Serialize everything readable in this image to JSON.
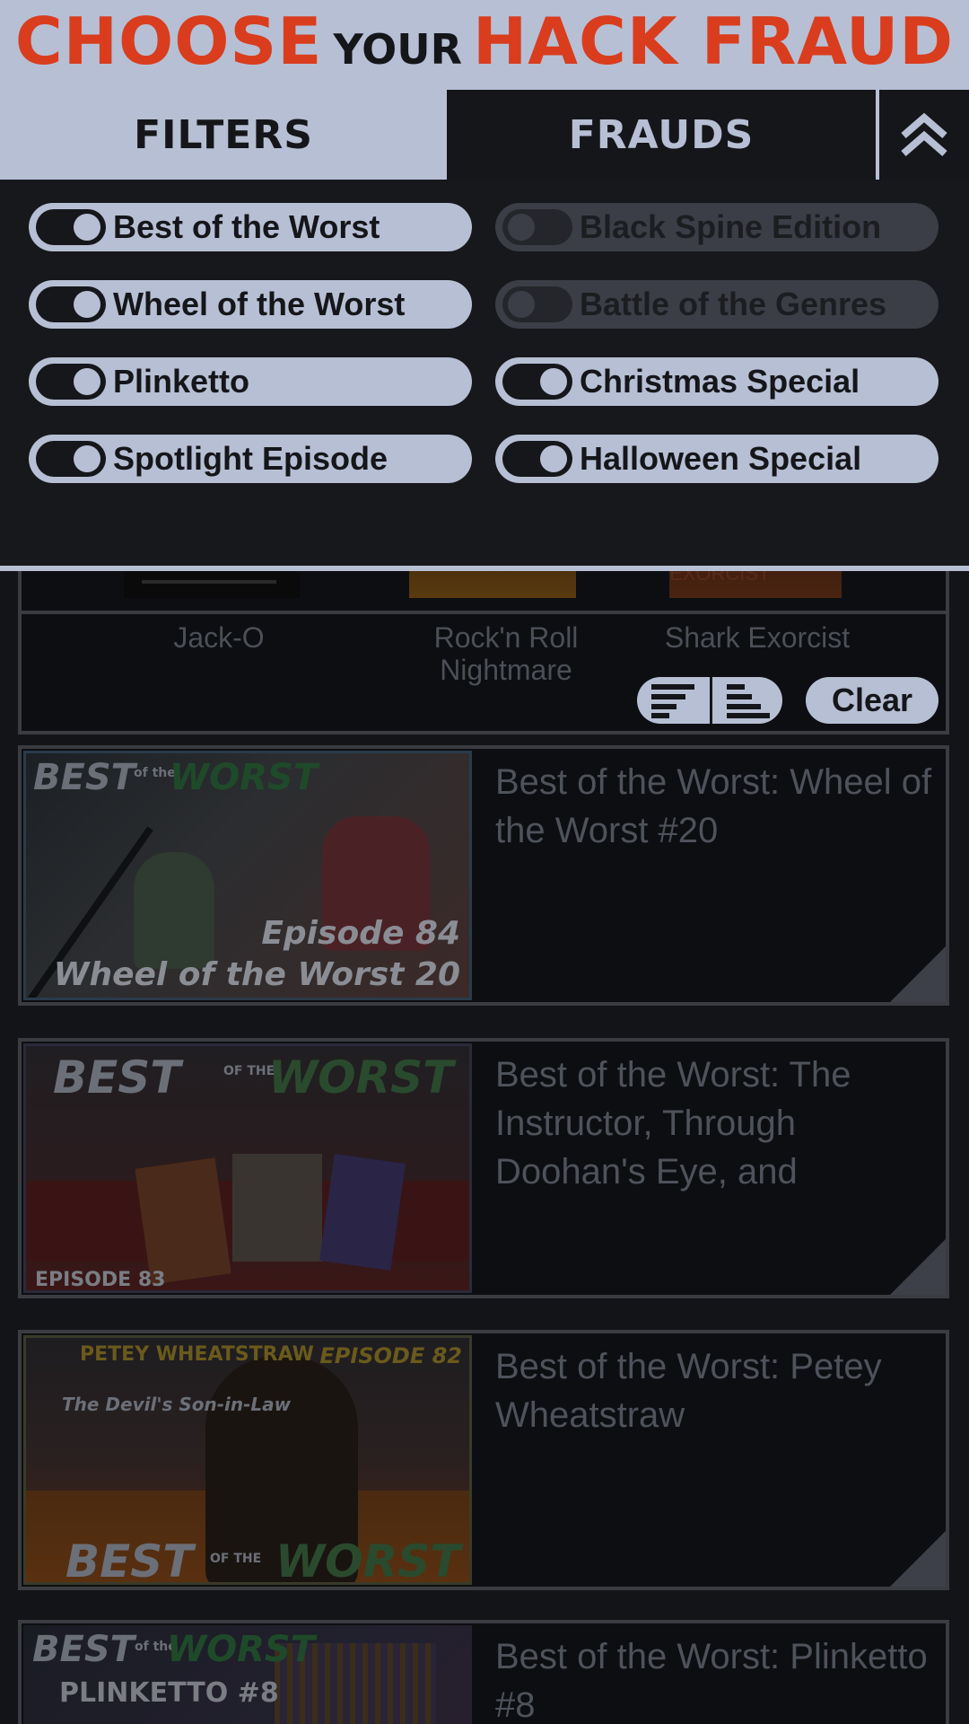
{
  "header": {
    "logo_choose": "CHOOSE",
    "logo_your": "YOUR",
    "logo_hack_fraud": "HACK FRAUD"
  },
  "tabs": {
    "filters_label": "FILTERS",
    "frauds_label": "FRAUDS",
    "collapse_icon": "double-chevron-up-icon"
  },
  "filters": {
    "left": [
      {
        "label": "Best of the Worst",
        "enabled": true
      },
      {
        "label": "Wheel of the Worst",
        "enabled": true
      },
      {
        "label": "Plinketto",
        "enabled": true
      },
      {
        "label": "Spotlight Episode",
        "enabled": true
      }
    ],
    "right": [
      {
        "label": "Black Spine Edition",
        "enabled": false
      },
      {
        "label": "Battle of the Genres",
        "enabled": false
      },
      {
        "label": "Christmas Special",
        "enabled": true
      },
      {
        "label": "Halloween Special",
        "enabled": true
      }
    ],
    "sort_left_icon": "align-left-icon",
    "sort_right_icon": "align-right-icon",
    "clear_label": "Clear"
  },
  "recent_card": {
    "items": [
      {
        "title": "Jack-O",
        "thumb_text": ""
      },
      {
        "title": "Rock'n Roll Nightmare",
        "thumb_text": ""
      },
      {
        "title": "Shark Exorcist",
        "thumb_text": "SHARK EXORCIST"
      }
    ]
  },
  "episodes": [
    {
      "title": "Best of the Worst: Wheel of the Worst #20",
      "thumb_brand_1": "BEST",
      "thumb_brand_of": "of the",
      "thumb_brand_2": "WORST",
      "thumb_line_1": "Episode 84",
      "thumb_line_2": "Wheel of the Worst 20"
    },
    {
      "title": "Best of the Worst: The Instructor, Through Doohan's Eye, and",
      "thumb_brand_1": "BEST",
      "thumb_brand_of": "OF THE",
      "thumb_brand_2": "WORST",
      "thumb_line_1": "EPISODE 83"
    },
    {
      "title": "Best of the Worst: Petey Wheatstraw",
      "thumb_brand_1": "BEST",
      "thumb_brand_of": "OF THE",
      "thumb_brand_2": "WORST",
      "thumb_line_1": "EPISODE 82",
      "thumb_line_2": "PETEY WHEATSTRAW",
      "thumb_line_3": "The Devil's Son-in-Law"
    },
    {
      "title": "Best of the Worst: Plinketto #8",
      "thumb_brand_1": "BEST",
      "thumb_brand_of": "of the",
      "thumb_brand_2": "WORST",
      "thumb_line_1": "PLINKETTO #8"
    }
  ],
  "colors": {
    "accent_orange": "#d93d1e",
    "panel_light": "#b7bfd4",
    "panel_dark": "#15161a"
  }
}
